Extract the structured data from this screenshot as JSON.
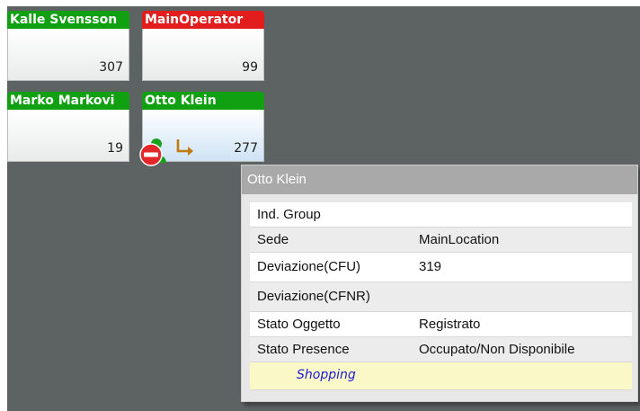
{
  "tiles": [
    {
      "name": "Kalle Svensson",
      "count": "307",
      "color": "#12a013"
    },
    {
      "name": "MainOperator",
      "count": "99",
      "color": "#e11d1d"
    },
    {
      "name": "Marko Markovi",
      "count": "19",
      "color": "#12a013"
    },
    {
      "name": "Otto Klein",
      "count": "277",
      "color": "#12a013"
    }
  ],
  "tooltip": {
    "title": "Otto Klein",
    "rows": [
      {
        "label": "Ind. Group",
        "value": ""
      },
      {
        "label": "Sede",
        "value": "MainLocation"
      },
      {
        "label": "Deviazione(CFU)",
        "value": "319"
      },
      {
        "label": "Deviazione(CFNR)",
        "value": ""
      },
      {
        "label": "Stato Oggetto",
        "value": "Registrato"
      },
      {
        "label": "Stato Presence",
        "value": "Occupato/Non Disponibile"
      }
    ],
    "presence_note": "Shopping"
  },
  "icons": {
    "presence": "do-not-disturb-presence-icon",
    "forward": "call-forward-icon"
  },
  "colors": {
    "background": "#5d6363",
    "available": "#12a013",
    "busy": "#e11d1d",
    "tooltip_header": "#a9a9a9",
    "status_note": "#1a1ad6"
  }
}
